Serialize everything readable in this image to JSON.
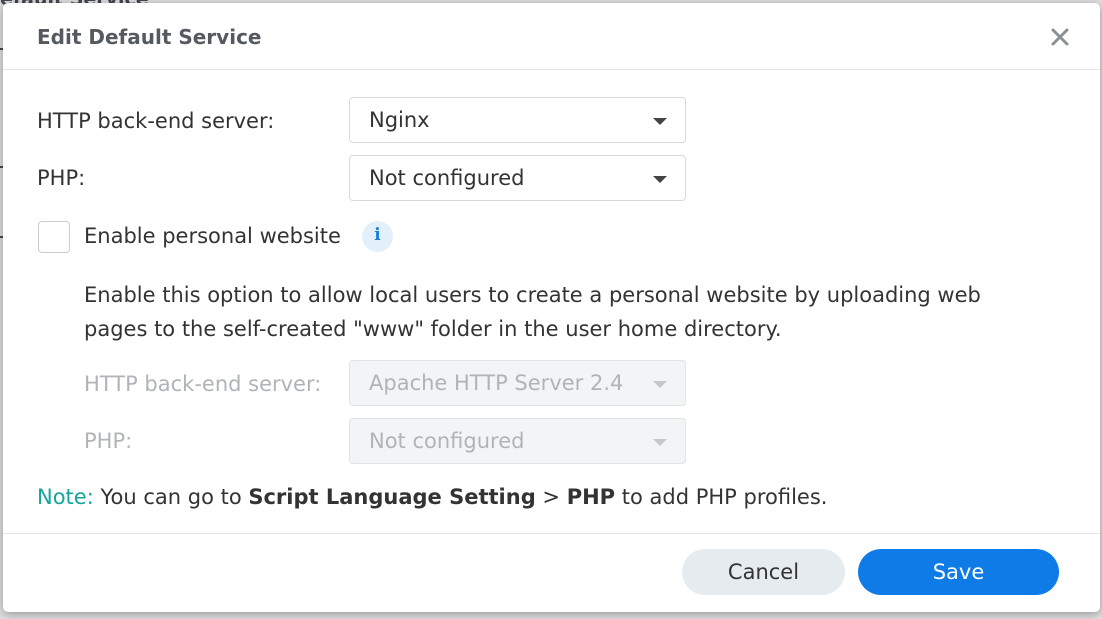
{
  "background": {
    "title_fragment": "efault Service"
  },
  "dialog": {
    "title": "Edit Default Service",
    "close_icon": "close-icon",
    "http_backend": {
      "label": "HTTP back-end server:",
      "value": "Nginx"
    },
    "php": {
      "label": "PHP:",
      "value": "Not configured"
    },
    "personal_website": {
      "label": "Enable personal website",
      "checked": false,
      "info_icon": "info-icon",
      "description": "Enable this option to allow local users to create a personal website by uploading web pages to the self-created \"www\" folder in the user home directory.",
      "http_backend": {
        "label": "HTTP back-end server:",
        "value": "Apache HTTP Server 2.4"
      },
      "php": {
        "label": "PHP:",
        "value": "Not configured"
      }
    },
    "note": {
      "label": "Note:",
      "text_before": " You can go to ",
      "link1": "Script Language Setting",
      "separator": " > ",
      "link2": "PHP",
      "text_after": " to add PHP profiles."
    },
    "buttons": {
      "cancel": "Cancel",
      "save": "Save"
    }
  },
  "colors": {
    "accent": "#0e7be6",
    "note": "#14a59b"
  }
}
